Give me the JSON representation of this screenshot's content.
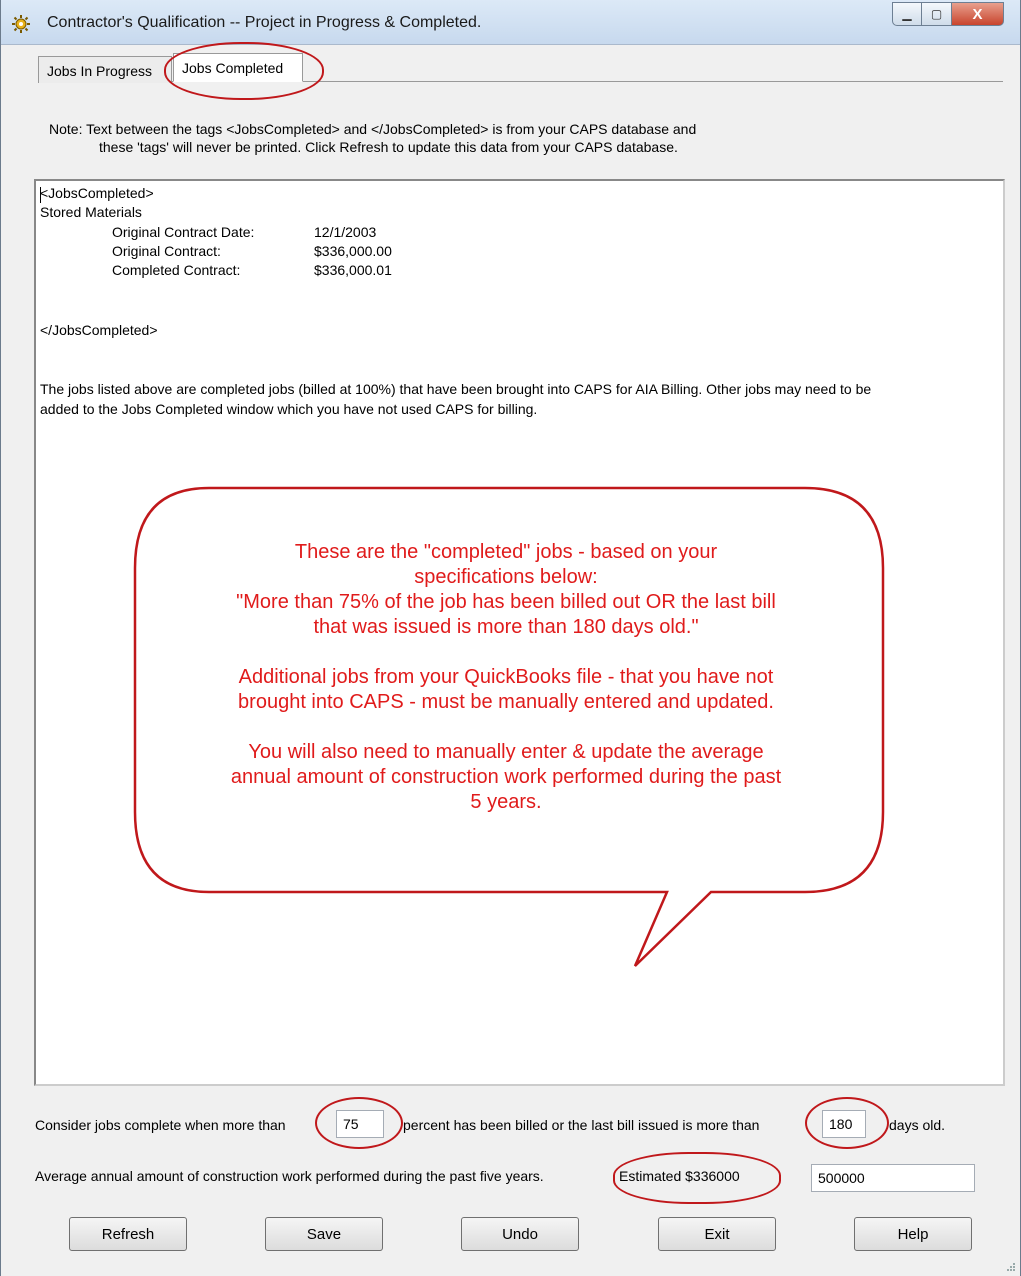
{
  "window": {
    "title": "Contractor's Qualification -- Project in Progress & Completed.",
    "close_glyph": "X",
    "min_glyph": "▁",
    "max_glyph": "▢"
  },
  "tabs": [
    {
      "label": "Jobs In Progress",
      "active": false
    },
    {
      "label": "Jobs Completed",
      "active": true
    }
  ],
  "note": {
    "line1": "Note:  Text between the tags <JobsCompleted> and  </JobsCompleted> is from your CAPS database and",
    "line2": "these 'tags' will never be printed. Click Refresh to update this data from your CAPS database."
  },
  "content": {
    "open_tag": "<JobsCompleted>",
    "job_name": "Stored Materials",
    "rows": [
      {
        "label": "Original Contract Date:",
        "value": "12/1/2003"
      },
      {
        "label": "Original Contract:",
        "value": "$336,000.00"
      },
      {
        "label": "Completed Contract:",
        "value": "$336,000.01"
      }
    ],
    "close_tag": "</JobsCompleted>",
    "paragraph_line1": "The jobs listed above are completed jobs (billed at 100%) that have been brought into CAPS for AIA Billing.  Other jobs may need to be",
    "paragraph_line2": "added to the Jobs Completed window which you have not used CAPS for billing."
  },
  "callout": {
    "lines": [
      "These are the \"completed\" jobs - based on your",
      "specifications below:",
      "\"More than 75% of the job has been billed out OR the last bill",
      "that was issued is more than 180 days old.\"",
      "",
      "Additional jobs from your QuickBooks file  - that you have not",
      "brought into CAPS - must be manually entered and updated.",
      "",
      "You will also need to manually enter & update the average",
      "annual amount of construction work performed during the past",
      "5 years."
    ],
    "color": "#e01b1b"
  },
  "settings": {
    "complete_label_before": "Consider jobs complete when more than",
    "percent_value": "75",
    "complete_label_middle": "percent has been billed or the last bill issued is more than",
    "days_value": "180",
    "complete_label_after": "days old.",
    "average_label": "Average annual amount of construction work performed during the past five years.",
    "estimated_text": "Estimated $336000",
    "average_value": "500000"
  },
  "buttons": {
    "refresh": "Refresh",
    "save": "Save",
    "undo": "Undo",
    "exit": "Exit",
    "help": "Help"
  },
  "annotation_color": "#c0181b"
}
